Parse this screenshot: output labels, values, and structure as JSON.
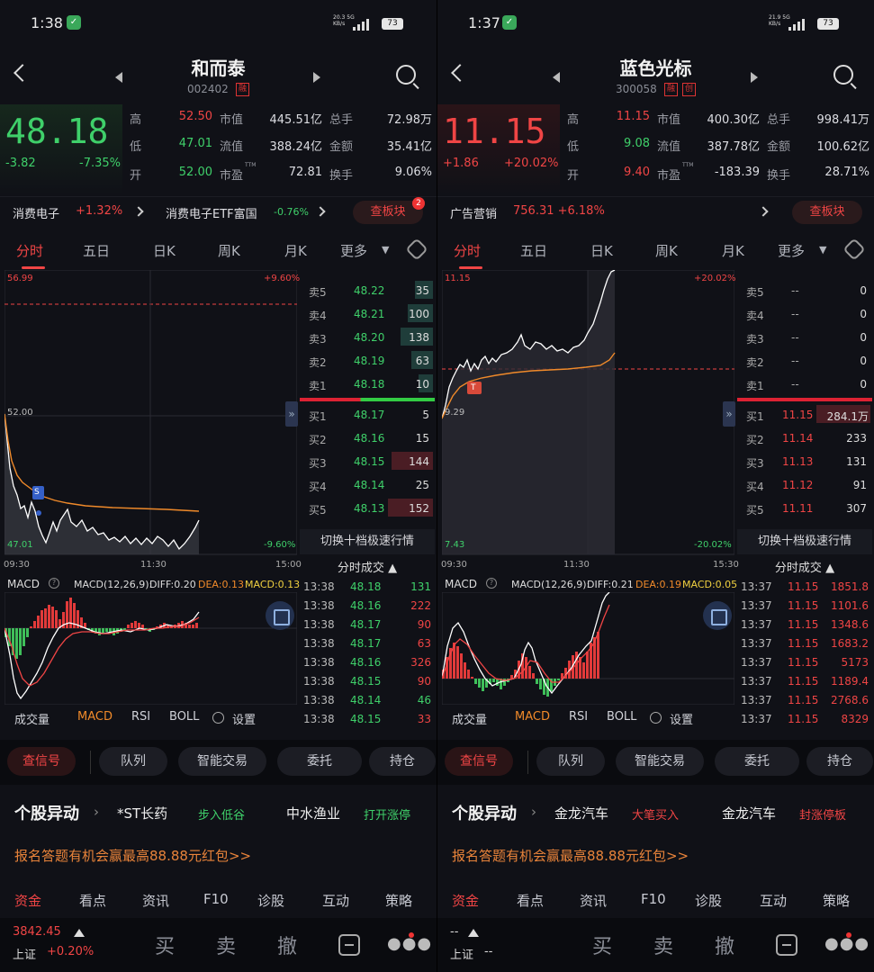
{
  "left": {
    "status": {
      "time": "1:38",
      "net_speed": "20.3",
      "net_unit": "KB/s",
      "net_gen": "5G",
      "battery": "73"
    },
    "stock": {
      "name": "和而泰",
      "code": "002402",
      "tags": [
        "融"
      ]
    },
    "price": {
      "last": "48.18",
      "chg": "-3.82",
      "pct": "-7.35%"
    },
    "quote_labels": {
      "high": "高",
      "low": "低",
      "open": "开",
      "mktcap": "市值",
      "float": "流值",
      "pe": "市盈",
      "pe_sup": "TTM",
      "vol": "总手",
      "amount": "金额",
      "turnover": "换手"
    },
    "quote": {
      "high": "52.50",
      "low": "47.01",
      "open": "52.00",
      "mktcap": "445.51亿",
      "float": "388.24亿",
      "pe": "72.81",
      "vol": "72.98万",
      "amount": "35.41亿",
      "turnover": "9.06%"
    },
    "sector": {
      "name1": "消费电子",
      "chg1": "+1.32%",
      "name2": "消费电子ETF富国",
      "chg2": "-0.76%",
      "board_btn": "查板块",
      "badge": "2"
    },
    "tabs": [
      "分时",
      "五日",
      "日K",
      "周K",
      "月K",
      "更多"
    ],
    "chart_labels": {
      "top_price": "56.99",
      "top_pct": "+9.60%",
      "mid_price": "52.00",
      "bot_price": "47.01",
      "bot_pct": "-9.60%",
      "t_start": "09:30",
      "t_mid": "11:30",
      "t_end": "15:00",
      "marker": "S"
    },
    "orderbook": {
      "sell": [
        {
          "label": "卖5",
          "price": "48.22",
          "vol": "35"
        },
        {
          "label": "卖4",
          "price": "48.21",
          "vol": "100"
        },
        {
          "label": "卖3",
          "price": "48.20",
          "vol": "138"
        },
        {
          "label": "卖2",
          "price": "48.19",
          "vol": "63"
        },
        {
          "label": "卖1",
          "price": "48.18",
          "vol": "10"
        }
      ],
      "buy": [
        {
          "label": "买1",
          "price": "48.17",
          "vol": "5"
        },
        {
          "label": "买2",
          "price": "48.16",
          "vol": "15"
        },
        {
          "label": "买3",
          "price": "48.15",
          "vol": "144"
        },
        {
          "label": "买4",
          "price": "48.14",
          "vol": "25"
        },
        {
          "label": "买5",
          "price": "48.13",
          "vol": "152"
        }
      ],
      "footer": "切换十档极速行情"
    },
    "macd": {
      "name": "MACD",
      "params": "MACD(12,26,9):",
      "diff": "DIFF:0.20",
      "dea": "DEA:0.13",
      "macd": "MACD:0.13"
    },
    "ind_tabs": [
      "成交量",
      "MACD",
      "RSI",
      "BOLL",
      "设置"
    ],
    "trades_title": "分时成交",
    "trades": [
      {
        "t": "13:38",
        "p": "48.18",
        "v": "131"
      },
      {
        "t": "13:38",
        "p": "48.16",
        "v": "222"
      },
      {
        "t": "13:38",
        "p": "48.17",
        "v": "90"
      },
      {
        "t": "13:38",
        "p": "48.17",
        "v": "63"
      },
      {
        "t": "13:38",
        "p": "48.16",
        "v": "326"
      },
      {
        "t": "13:38",
        "p": "48.15",
        "v": "90"
      },
      {
        "t": "13:38",
        "p": "48.14",
        "v": "46"
      },
      {
        "t": "13:38",
        "p": "48.15",
        "v": "33"
      }
    ],
    "actions": [
      "查信号",
      "队列",
      "智能交易",
      "委托",
      "持仓"
    ],
    "anomaly": {
      "title": "个股异动",
      "s1": "*ST长药",
      "e1": "步入低谷",
      "s2": "中水渔业",
      "e2": "打开涨停"
    },
    "promo": "报名答题有机会赢最高88.88元红包>>",
    "bottom_tabs": [
      "资金",
      "看点",
      "资讯",
      "F10",
      "诊股",
      "互动",
      "策略"
    ],
    "index": {
      "value": "3842.45",
      "name": "上证",
      "chg": "+0.20%"
    },
    "bottom_actions": [
      "买",
      "卖",
      "撤"
    ]
  },
  "right": {
    "status": {
      "time": "1:37",
      "net_speed": "21.9",
      "net_unit": "KB/s",
      "net_gen": "5G",
      "battery": "73"
    },
    "stock": {
      "name": "蓝色光标",
      "code": "300058",
      "tags": [
        "融",
        "创"
      ]
    },
    "price": {
      "last": "11.15",
      "chg": "+1.86",
      "pct": "+20.02%"
    },
    "quote_labels": {
      "high": "高",
      "low": "低",
      "open": "开",
      "mktcap": "市值",
      "float": "流值",
      "pe": "市盈",
      "pe_sup": "TTM",
      "vol": "总手",
      "amount": "金额",
      "turnover": "换手"
    },
    "quote": {
      "high": "11.15",
      "low": "9.08",
      "open": "9.40",
      "mktcap": "400.30亿",
      "float": "387.78亿",
      "pe": "-183.39",
      "vol": "998.41万",
      "amount": "100.62亿",
      "turnover": "28.71%"
    },
    "sector": {
      "name1": "广告营销",
      "chg1": "756.31 +6.18%",
      "board_btn": "查板块"
    },
    "tabs": [
      "分时",
      "五日",
      "日K",
      "周K",
      "月K",
      "更多"
    ],
    "chart_labels": {
      "top_price": "11.15",
      "top_pct": "+20.02%",
      "mid_price": "9.29",
      "bot_price": "7.43",
      "bot_pct": "-20.02%",
      "t_start": "09:30",
      "t_mid": "11:30",
      "t_end": "15:30",
      "marker": "T"
    },
    "orderbook": {
      "sell": [
        {
          "label": "卖5",
          "price": "--",
          "vol": "0"
        },
        {
          "label": "卖4",
          "price": "--",
          "vol": "0"
        },
        {
          "label": "卖3",
          "price": "--",
          "vol": "0"
        },
        {
          "label": "卖2",
          "price": "--",
          "vol": "0"
        },
        {
          "label": "卖1",
          "price": "--",
          "vol": "0"
        }
      ],
      "buy": [
        {
          "label": "买1",
          "price": "11.15",
          "vol": "284.1万"
        },
        {
          "label": "买2",
          "price": "11.14",
          "vol": "233"
        },
        {
          "label": "买3",
          "price": "11.13",
          "vol": "131"
        },
        {
          "label": "买4",
          "price": "11.12",
          "vol": "91"
        },
        {
          "label": "买5",
          "price": "11.11",
          "vol": "307"
        }
      ],
      "footer": "切换十档极速行情"
    },
    "macd": {
      "name": "MACD",
      "params": "MACD(12,26,9):",
      "diff": "DIFF:0.21",
      "dea": "DEA:0.19",
      "macd": "MACD:0.05"
    },
    "ind_tabs": [
      "成交量",
      "MACD",
      "RSI",
      "BOLL",
      "设置"
    ],
    "trades_title": "分时成交",
    "trades": [
      {
        "t": "13:37",
        "p": "11.15",
        "v": "1851.8"
      },
      {
        "t": "13:37",
        "p": "11.15",
        "v": "1101.6"
      },
      {
        "t": "13:37",
        "p": "11.15",
        "v": "1348.6"
      },
      {
        "t": "13:37",
        "p": "11.15",
        "v": "1683.2"
      },
      {
        "t": "13:37",
        "p": "11.15",
        "v": "5173"
      },
      {
        "t": "13:37",
        "p": "11.15",
        "v": "1189.4"
      },
      {
        "t": "13:37",
        "p": "11.15",
        "v": "2768.6"
      },
      {
        "t": "13:37",
        "p": "11.15",
        "v": "8329"
      }
    ],
    "actions": [
      "查信号",
      "队列",
      "智能交易",
      "委托",
      "持仓"
    ],
    "anomaly": {
      "title": "个股异动",
      "s1": "金龙汽车",
      "e1": "大笔买入",
      "s2": "金龙汽车",
      "e2": "封涨停板"
    },
    "promo": "报名答题有机会赢最高88.88元红包>>",
    "bottom_tabs": [
      "资金",
      "看点",
      "资讯",
      "F10",
      "诊股",
      "互动",
      "策略"
    ],
    "index": {
      "value": "--",
      "name": "上证",
      "chg": "--"
    },
    "bottom_actions": [
      "买",
      "卖",
      "撤"
    ]
  },
  "colors": {
    "up": "#f04545",
    "down": "#3fd06a",
    "avg": "#f08a2a",
    "price_line": "#ffffff",
    "bg": "#101117"
  }
}
